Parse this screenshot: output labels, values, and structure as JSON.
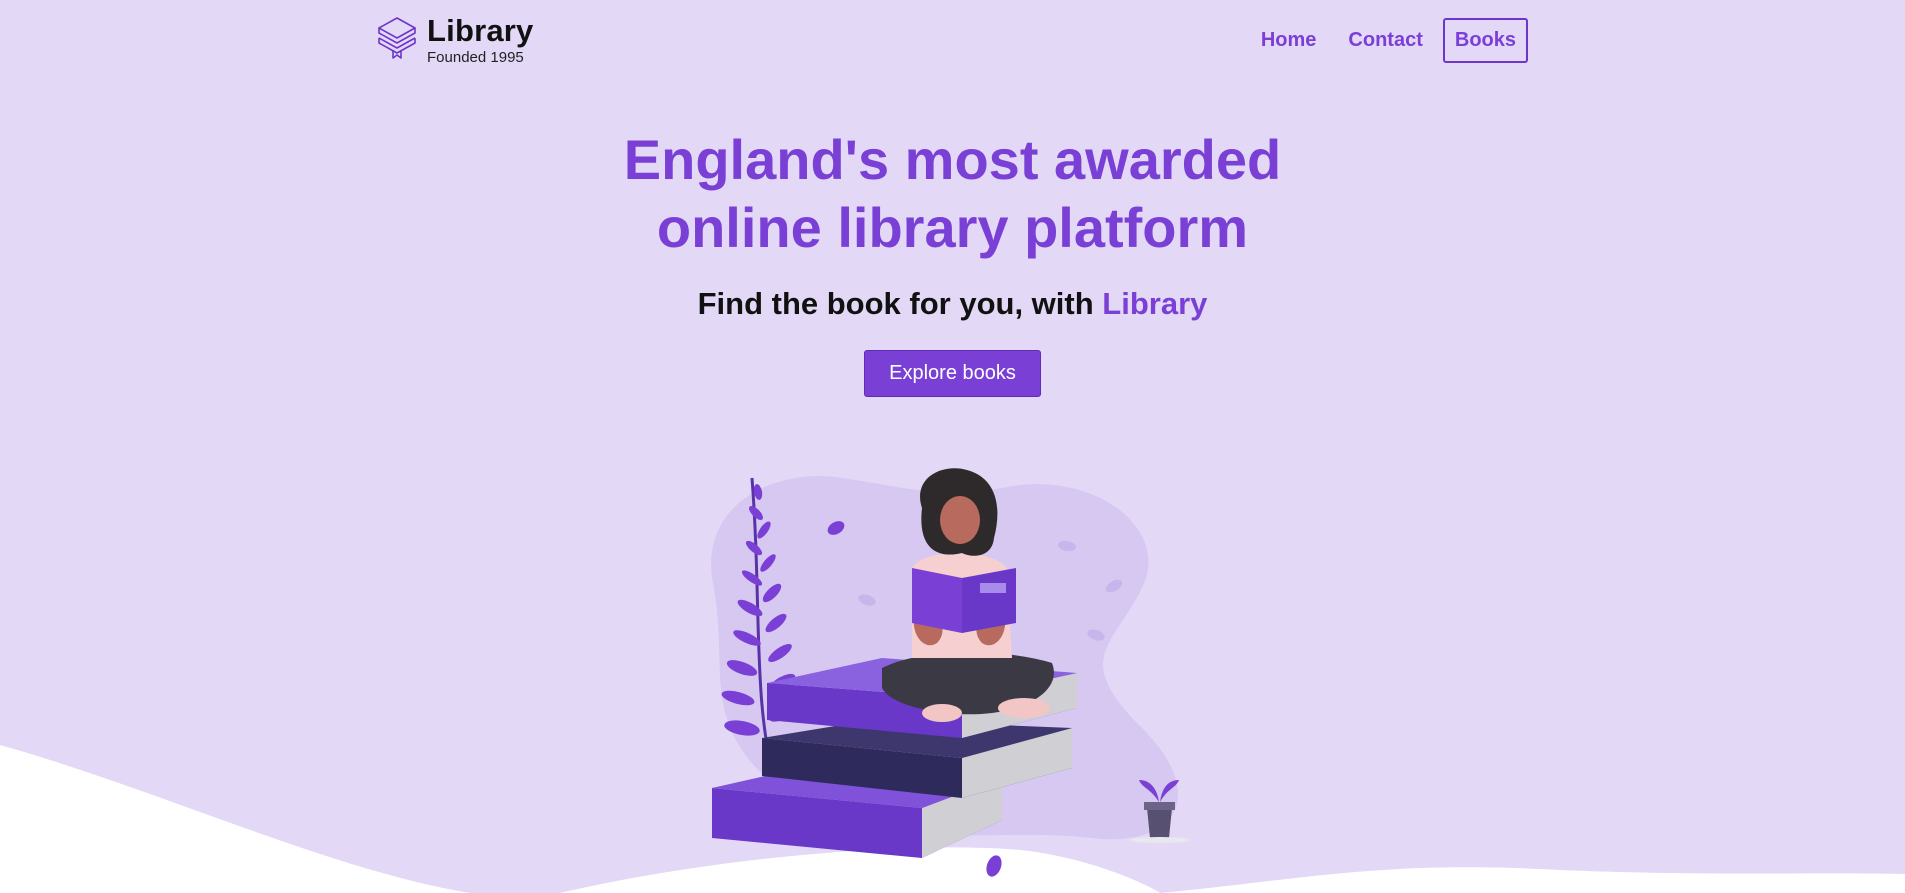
{
  "brand": {
    "name": "Library",
    "tagline": "Founded 1995",
    "logo_icon": "stacked-books-icon"
  },
  "nav": {
    "items": [
      {
        "label": "Home",
        "active": false
      },
      {
        "label": "Contact",
        "active": false
      },
      {
        "label": "Books",
        "active": true
      }
    ]
  },
  "hero": {
    "headline_line1": "England's most awarded",
    "headline_line2": "online library platform",
    "subtitle_prefix": "Find the book for you, with ",
    "subtitle_accent": "Library",
    "cta_label": "Explore books",
    "illustration": "woman-reading-on-books-illustration"
  },
  "colors": {
    "background": "#e3d9f7",
    "accent": "#7a40d6",
    "text": "#111111",
    "white_wave": "#ffffff"
  }
}
